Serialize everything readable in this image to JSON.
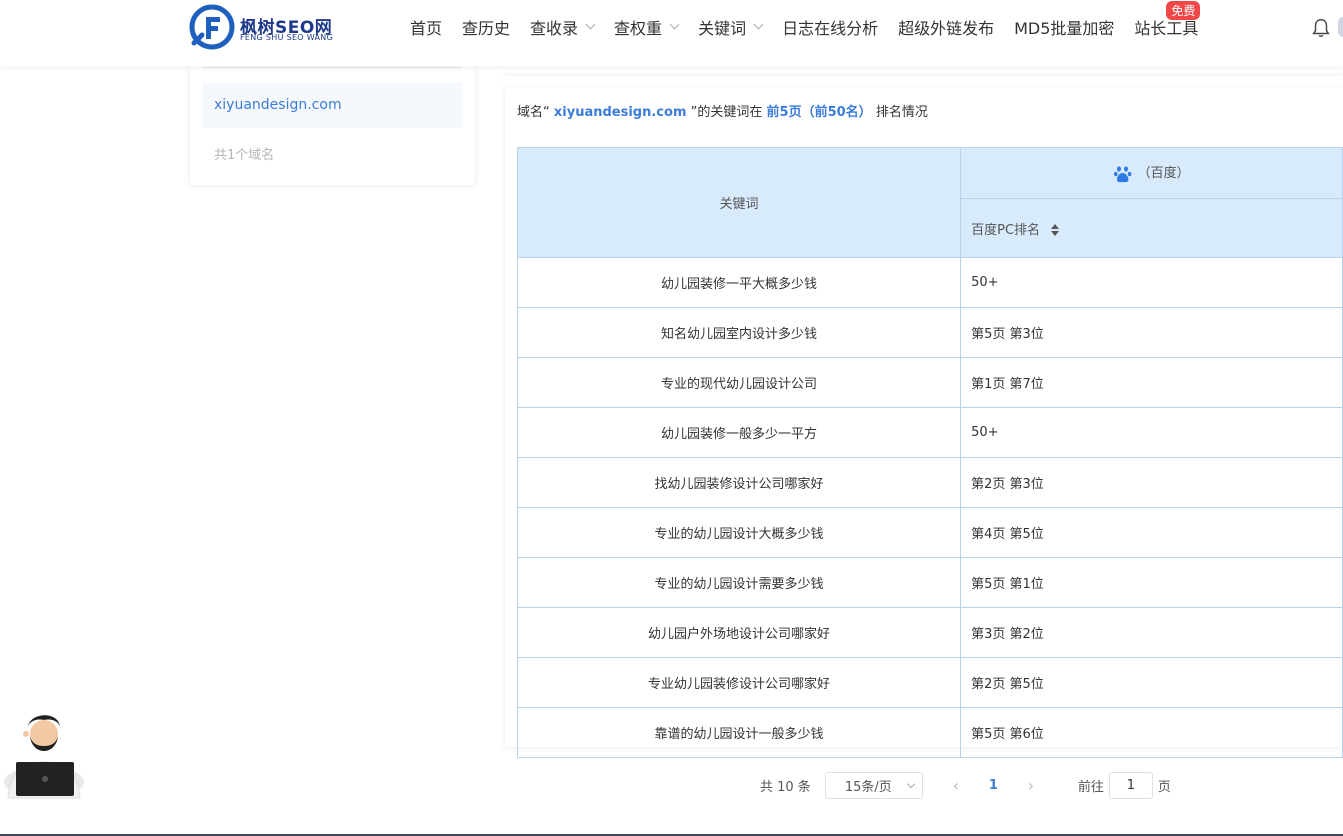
{
  "header": {
    "logo_text": "枫树SEO网",
    "logo_sub": "FENG SHU SEO WANG",
    "nav": [
      {
        "label": "首页",
        "dropdown": false
      },
      {
        "label": "查历史",
        "dropdown": false
      },
      {
        "label": "查收录",
        "dropdown": true
      },
      {
        "label": "查权重",
        "dropdown": true
      },
      {
        "label": "关键词",
        "dropdown": true
      },
      {
        "label": "日志在线分析",
        "dropdown": false
      },
      {
        "label": "超级外链发布",
        "dropdown": false
      },
      {
        "label": "MD5批量加密",
        "dropdown": false
      },
      {
        "label": "站长工具",
        "dropdown": false,
        "badge": "免费"
      }
    ]
  },
  "sidebar": {
    "domain": "xiyuandesign.com",
    "count_text": "共1个域名"
  },
  "summary": {
    "prefix": "域名“",
    "domain": "xiyuandesign.com",
    "middle": "”的关键词在",
    "range": "前5页（前50名）",
    "suffix": "排名情况"
  },
  "table": {
    "col_keyword": "关键词",
    "engine_label": "（百度）",
    "col_rank": "百度PC排名",
    "rows": [
      {
        "keyword": "幼儿园装修一平大概多少钱",
        "rank": "50+"
      },
      {
        "keyword": "知名幼儿园室内设计多少钱",
        "rank": "第5页 第3位"
      },
      {
        "keyword": "专业的现代幼儿园设计公司",
        "rank": "第1页 第7位"
      },
      {
        "keyword": "幼儿园装修一般多少一平方",
        "rank": "50+"
      },
      {
        "keyword": "找幼儿园装修设计公司哪家好",
        "rank": "第2页 第3位"
      },
      {
        "keyword": "专业的幼儿园设计大概多少钱",
        "rank": "第4页 第5位"
      },
      {
        "keyword": "专业的幼儿园设计需要多少钱",
        "rank": "第5页 第1位"
      },
      {
        "keyword": "幼儿园户外场地设计公司哪家好",
        "rank": "第3页 第2位"
      },
      {
        "keyword": "专业幼儿园装修设计公司哪家好",
        "rank": "第2页 第5位"
      },
      {
        "keyword": "靠谱的幼儿园设计一般多少钱",
        "rank": "第5页 第6位"
      }
    ]
  },
  "pager": {
    "total_text": "共 10 条",
    "page_size": "15条/页",
    "current_page": "1",
    "goto_label": "前往",
    "goto_value": "1",
    "page_suffix": "页"
  },
  "colors": {
    "accent": "#3b7dd8",
    "table_header": "#d8ebfd",
    "badge": "#f04848"
  }
}
